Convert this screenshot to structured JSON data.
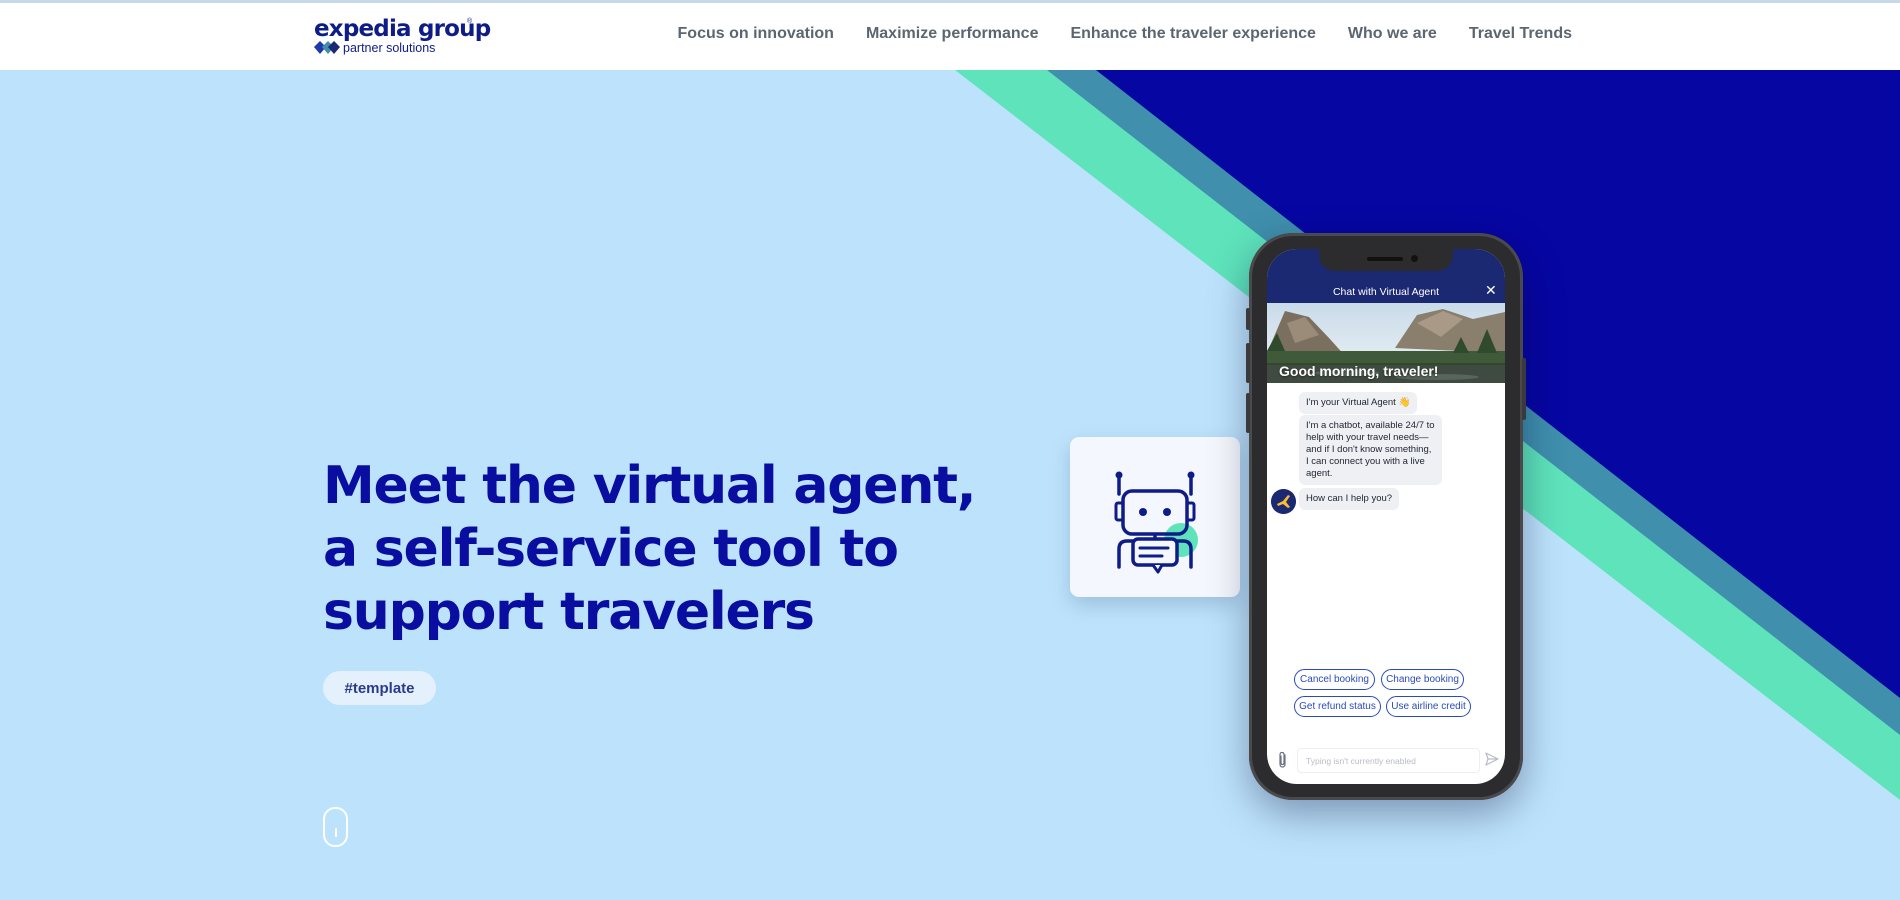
{
  "brand": {
    "name": "expedia group",
    "trademark": "®",
    "sub": "partner solutions"
  },
  "nav": {
    "items": [
      {
        "label": "Focus on innovation"
      },
      {
        "label": "Maximize performance"
      },
      {
        "label": "Enhance the traveler experience"
      },
      {
        "label": "Who we are"
      },
      {
        "label": "Travel Trends"
      }
    ]
  },
  "hero": {
    "headline_lines": [
      "Meet the virtual agent,",
      "a self-service tool to",
      "support travelers"
    ],
    "tag": "#template"
  },
  "phone": {
    "chat_title": "Chat with Virtual Agent",
    "close": "✕",
    "greeting": "Good morning, traveler!",
    "messages": [
      "I'm your Virtual Agent 👋",
      "I'm a chatbot, available 24/7 to help with your travel needs—and if I don't know something, I can connect you with a live agent.",
      "How can I help you?"
    ],
    "chips": [
      "Cancel booking",
      "Change booking",
      "Get refund status",
      "Use airline credit"
    ],
    "input_placeholder": "Typing isn't currently enabled"
  },
  "colors": {
    "hero_bg": "#bde3fc",
    "navy": "#0a0ea0",
    "teal": "#5ee3bb",
    "steel": "#3f8fad",
    "nav_text": "#5b6670"
  }
}
